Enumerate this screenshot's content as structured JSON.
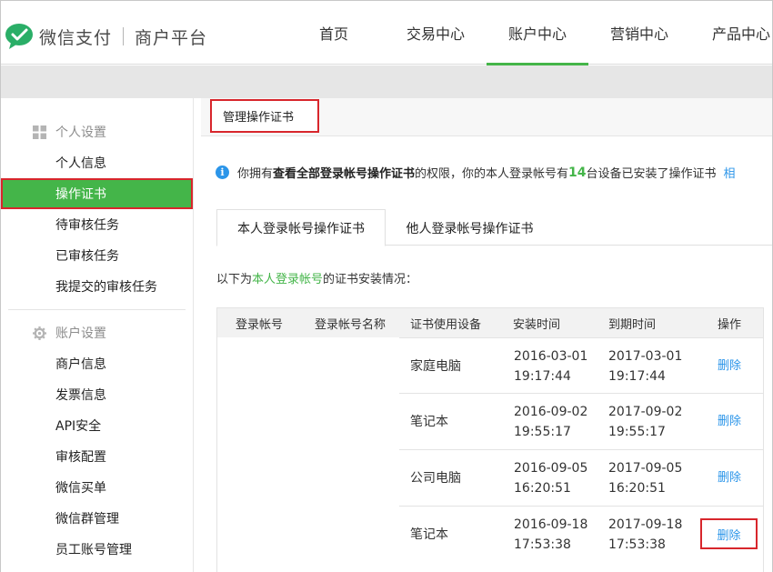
{
  "header": {
    "brand": "微信支付",
    "platform": "商户平台",
    "nav": [
      "首页",
      "交易中心",
      "账户中心",
      "营销中心",
      "产品中心"
    ],
    "active_nav": "账户中心"
  },
  "sidebar": {
    "group1": {
      "title": "个人设置",
      "icon": "grid-icon"
    },
    "group1_items": [
      "个人信息",
      "操作证书",
      "待审核任务",
      "已审核任务",
      "我提交的审核任务"
    ],
    "group2": {
      "title": "账户设置",
      "icon": "gear-icon"
    },
    "group2_items": [
      "商户信息",
      "发票信息",
      "API安全",
      "审核配置",
      "微信买单",
      "微信群管理",
      "员工账号管理"
    ],
    "active_item": "操作证书"
  },
  "main": {
    "breadcrumb": "管理操作证书",
    "notice": {
      "prefix": "你拥有",
      "bold": "查看全部登录帐号操作证书",
      "middle": "的权限，你的本人登录帐号有",
      "count": "14",
      "suffix": "台设备已安装了操作证书",
      "link": "相"
    },
    "tabs": [
      "本人登录帐号操作证书",
      "他人登录帐号操作证书"
    ],
    "subtitle": {
      "prefix": "以下为",
      "highlight": "本人登录帐号",
      "suffix": "的证书安装情况："
    },
    "table": {
      "headers": [
        "登录帐号",
        "登录帐号名称",
        "证书使用设备",
        "安装时间",
        "到期时间",
        "操作"
      ],
      "rows": [
        {
          "device": "家庭电脑",
          "install_date": "2016-03-01",
          "install_time": "19:17:44",
          "expire_date": "2017-03-01",
          "expire_time": "19:17:44",
          "action": "删除"
        },
        {
          "device": "笔记本",
          "install_date": "2016-09-02",
          "install_time": "19:55:17",
          "expire_date": "2017-09-02",
          "expire_time": "19:55:17",
          "action": "删除"
        },
        {
          "device": "公司电脑",
          "install_date": "2016-09-05",
          "install_time": "16:20:51",
          "expire_date": "2017-09-05",
          "expire_time": "16:20:51",
          "action": "删除"
        },
        {
          "device": "笔记本",
          "install_date": "2016-09-18",
          "install_time": "17:53:38",
          "expire_date": "2017-09-18",
          "expire_time": "17:53:38",
          "action": "删除"
        }
      ]
    }
  },
  "colors": {
    "brand_green": "#44b549",
    "highlight_red": "#d8262c",
    "link_blue": "#2b95e9"
  }
}
